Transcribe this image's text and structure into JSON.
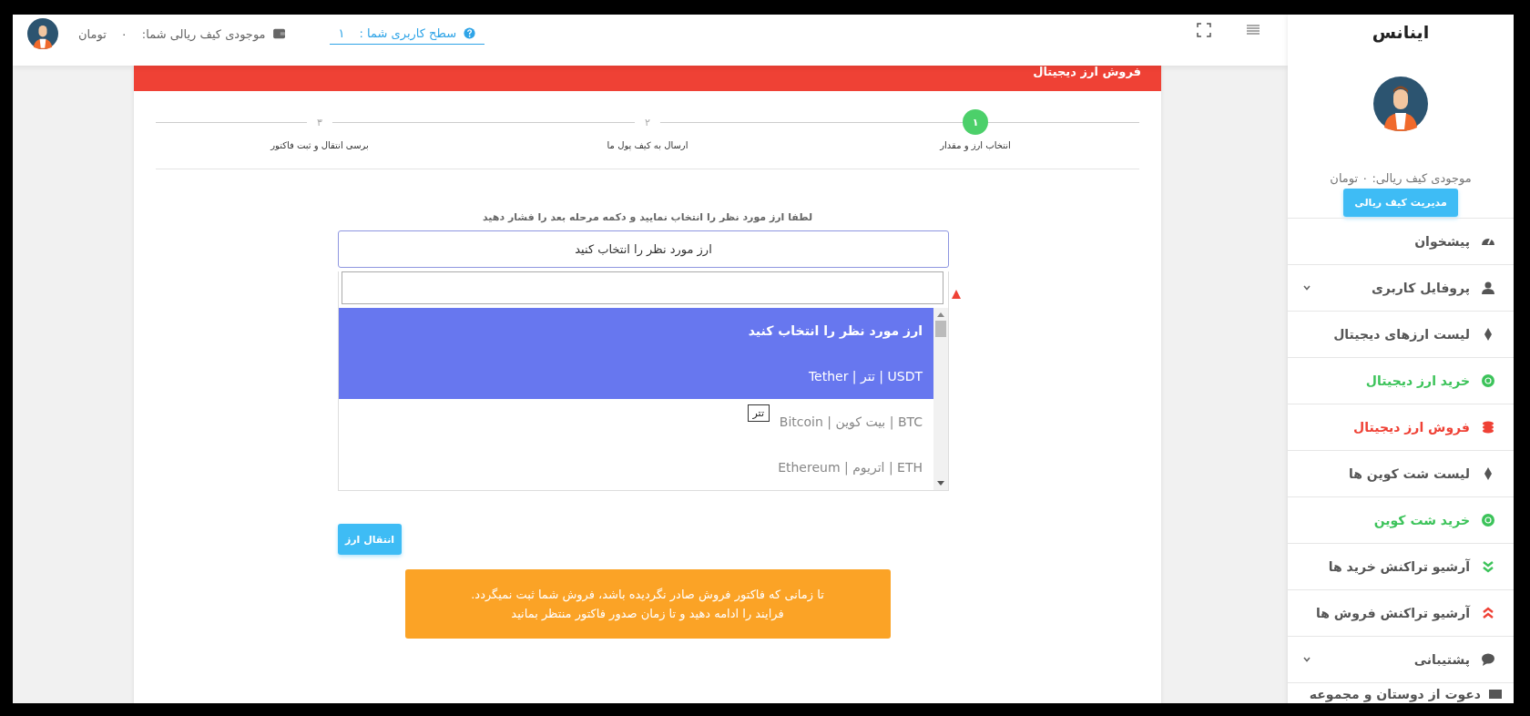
{
  "topbar": {
    "user_level": {
      "label": "سطح کاربری شما :",
      "value": "١"
    },
    "wallet": {
      "label": "موجودی کیف ریالی شما:",
      "amount": "٠",
      "unit": "تومان"
    }
  },
  "card": {
    "title": "فروش ارز دیجیتال",
    "steps": [
      {
        "number": "١",
        "label": "انتخاب ارز و مقدار",
        "active": true
      },
      {
        "number": "٢",
        "label": "ارسال به کیف پول ما",
        "active": false
      },
      {
        "number": "٣",
        "label": "برسی انتقال و ثبت فاکتور",
        "active": false
      }
    ],
    "instruction": "لطفا ارز مورد نظر را انتخاب نمایید و دکمه مرحله بعد را فشار دهید",
    "select": {
      "value": "ارز مورد نظر را انتخاب کنید",
      "options": [
        {
          "label": "ارز مورد نظر را انتخاب کنید",
          "selected": true,
          "highlighted": true
        },
        {
          "label": "Tether | تتر | USDT",
          "selected": false,
          "highlighted": true
        },
        {
          "label": "Bitcoin | بیت کوین | BTC",
          "selected": false,
          "highlighted": false
        },
        {
          "label": "Ethereum | اتریوم | ETH",
          "selected": false,
          "highlighted": false
        }
      ],
      "tooltip": "تتر"
    },
    "button": "انتقال ارز",
    "alert": [
      "تا زمانی که فاکتور فروش صادر نگردیده باشد، فروش شما ثبت نمیگردد.",
      "فرایند را ادامه دهید و تا زمان صدور فاکتور منتظر بمانید"
    ]
  },
  "sidebar": {
    "brand": "اینانس",
    "wallet": "موجودی کیف ریالی: ٠ تومان",
    "wallet_button": "مدیریت کیف ریالی",
    "items": [
      {
        "label": "پیشخوان",
        "kind": "gauge",
        "color": "#555555",
        "expandable": false
      },
      {
        "label": "پروفایل کاربری",
        "kind": "user",
        "color": "#555555",
        "expandable": true
      },
      {
        "label": "لیست ارزهای دیجیتال",
        "kind": "diamond",
        "color": "#555555",
        "expandable": false
      },
      {
        "label": "خرید ارز دیجیتال",
        "kind": "coin",
        "color": "#3cc35a",
        "expandable": false
      },
      {
        "label": "فروش ارز دیجیتال",
        "kind": "coins",
        "color": "#ef4135",
        "expandable": false
      },
      {
        "label": "لیست شت کوین ها",
        "kind": "diamond",
        "color": "#555555",
        "expandable": false
      },
      {
        "label": "خرید شت کوین",
        "kind": "coin",
        "color": "#3cc35a",
        "expandable": false
      },
      {
        "label": "آرشیو تراکنش خرید ها",
        "kind": "down",
        "color": "#555555",
        "expandable": false
      },
      {
        "label": "آرشیو تراکنش فروش ها",
        "kind": "up",
        "color": "#555555",
        "expandable": false
      },
      {
        "label": "پشتیبانی",
        "kind": "chat",
        "color": "#555555",
        "expandable": true
      },
      {
        "label": "دعوت از دوستان و مجموعه",
        "kind": "invite",
        "color": "#555555",
        "expandable": false
      }
    ]
  }
}
